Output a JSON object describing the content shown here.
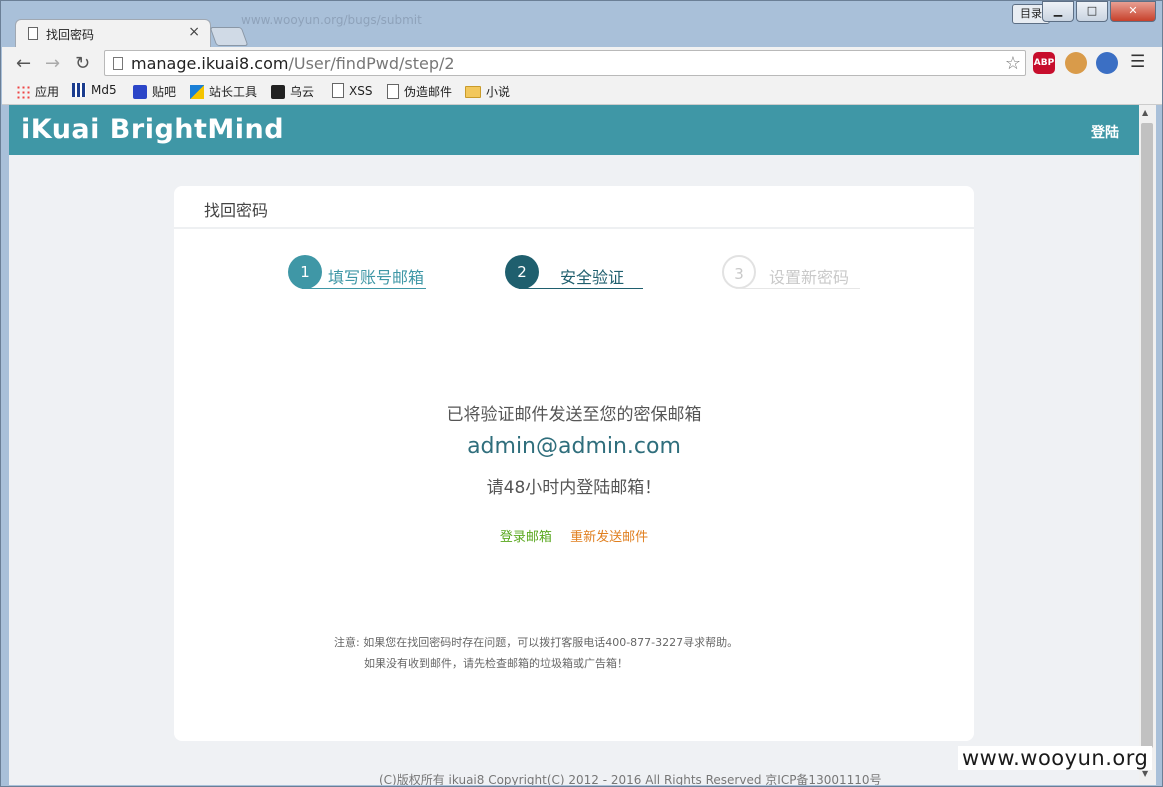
{
  "browser": {
    "tab_title": "找回密码",
    "tab_close": "×",
    "ghost_url": "www.wooyun.org/bugs/submit",
    "lang_button": "目录",
    "url_host": "manage.ikuai8.com",
    "url_path": "/User/findPwd/step/2",
    "ext_abp": "ABP"
  },
  "bookmarks": [
    {
      "label": "应用",
      "icon": "apps-icon"
    },
    {
      "label": "Md5",
      "icon": "grid-icon"
    },
    {
      "label": "贴吧",
      "icon": "paw-icon"
    },
    {
      "label": "站长工具",
      "icon": "tool-icon"
    },
    {
      "label": "乌云",
      "icon": "wooyun-icon"
    },
    {
      "label": "XSS",
      "icon": "doc-icon"
    },
    {
      "label": "伪造邮件",
      "icon": "doc-icon"
    },
    {
      "label": "小说",
      "icon": "folder-icon"
    }
  ],
  "site": {
    "brand": "iKuai BrightMind",
    "login": "登陆"
  },
  "card": {
    "title": "找回密码",
    "steps": [
      {
        "num": "1",
        "label": "填写账号邮箱",
        "state": "done"
      },
      {
        "num": "2",
        "label": "安全验证",
        "state": "active"
      },
      {
        "num": "3",
        "label": "设置新密码",
        "state": "pending"
      }
    ],
    "sent_msg": "已将验证邮件发送至您的密保邮箱",
    "email": "admin@admin.com",
    "hours_msg": "请48小时内登陆邮箱！",
    "login_mail": "登录邮箱",
    "resend": "重新发送邮件",
    "note1": "注意: 如果您在找回密码时存在问题，可以拨打客服电话400-877-3227寻求帮助。",
    "note2": "如果没有收到邮件，请先检查邮箱的垃圾箱或广告箱！"
  },
  "footer": "(C)版权所有  ikuai8 Copyright(C) 2012 - 2016 All Rights Reserved 京ICP备13001110号",
  "watermark": "www.wooyun.org",
  "colors": {
    "header": "#3f97a6",
    "step_active": "#1f5f6e",
    "login_link": "#5aa81f",
    "resend_link": "#e07f1f"
  }
}
